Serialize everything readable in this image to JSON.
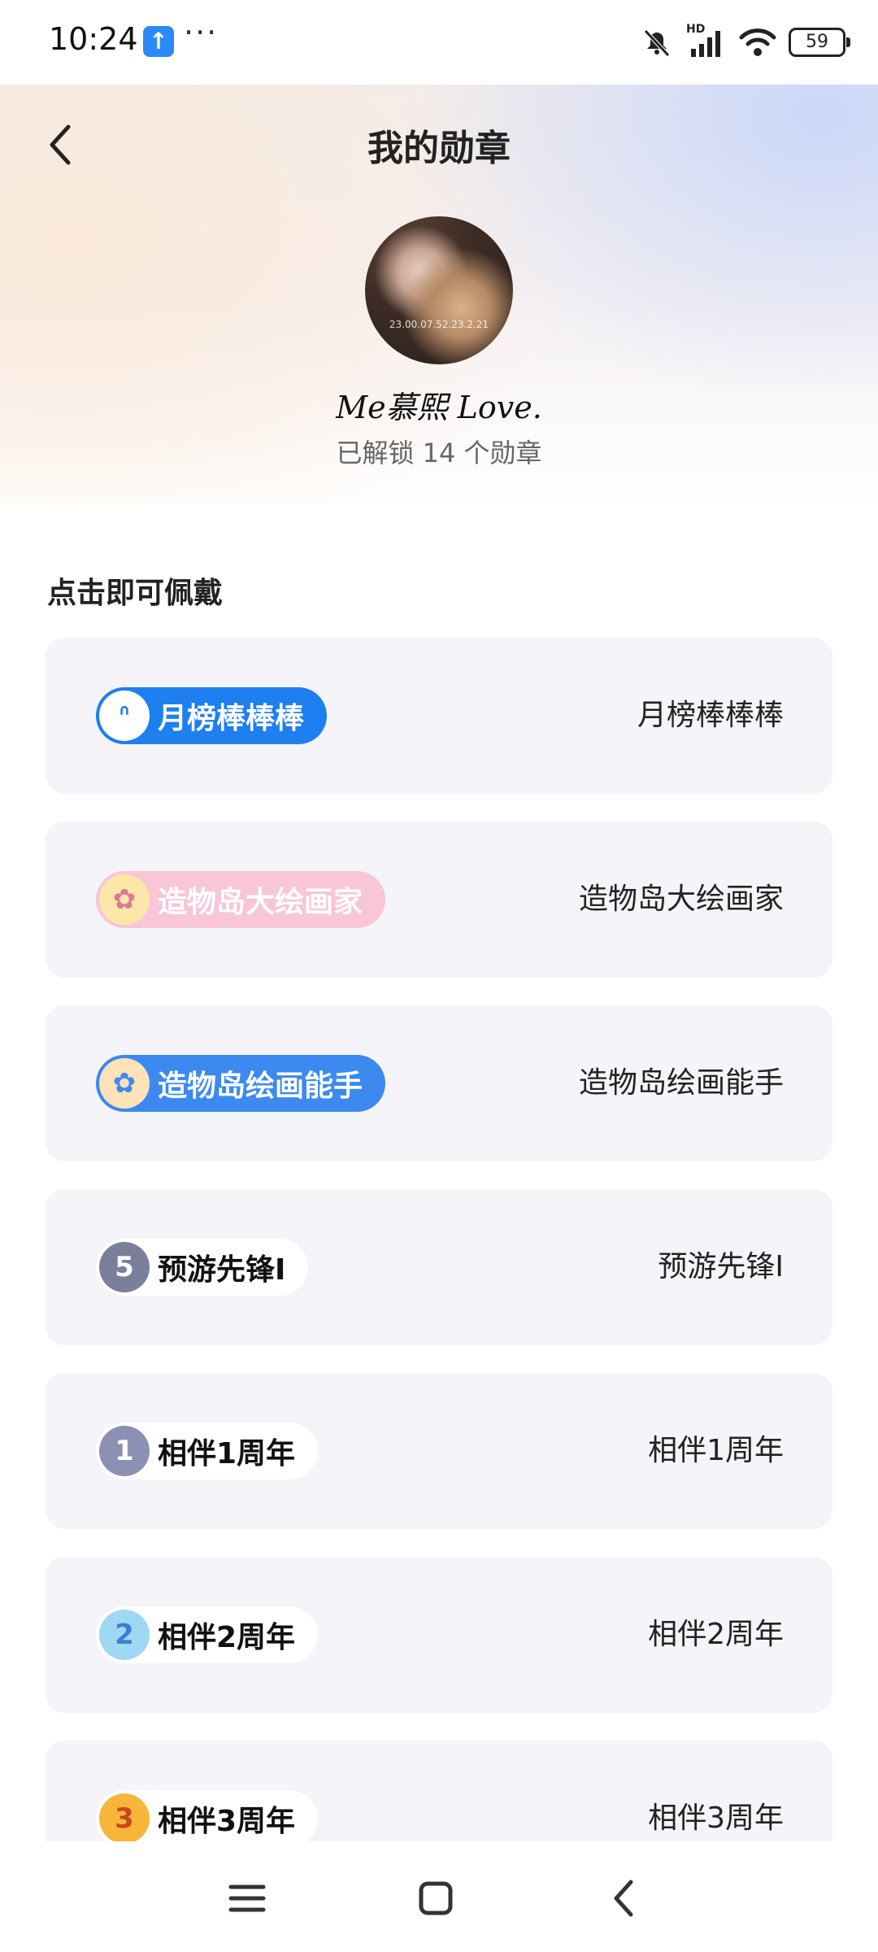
{
  "status_bar": {
    "time": "10:24",
    "battery": "59",
    "network_label": "HD"
  },
  "header": {
    "title": "我的勋章"
  },
  "profile": {
    "avatar_caption": "23.00.07.52.23.2.21",
    "username": "Me慕熙 Love.",
    "unlock_summary": "已解锁 14 个勋章"
  },
  "section": {
    "title": "点击即可佩戴"
  },
  "badges": [
    {
      "pill_label": "月榜棒棒棒",
      "name": "月榜棒棒棒",
      "pill_bg": "#1d7ff0",
      "pill_text": "#ffffff",
      "icon": "bunny-icon",
      "icon_glyph": "ᐢ",
      "icon_bg": "#ffffff",
      "icon_color": "#1d7ff0"
    },
    {
      "pill_label": "造物岛大绘画家",
      "name": "造物岛大绘画家",
      "pill_bg": "#f8c6d6",
      "pill_text": "#ffffff",
      "icon": "anime-girl-icon",
      "icon_glyph": "✿",
      "icon_bg": "#fde7a8",
      "icon_color": "#e07896"
    },
    {
      "pill_label": "造物岛绘画能手",
      "name": "造物岛绘画能手",
      "pill_bg": "#3c8af0",
      "pill_text": "#ffffff",
      "icon": "anime-girl-icon",
      "icon_glyph": "✿",
      "icon_bg": "#ffe2b8",
      "icon_color": "#3c8af0"
    },
    {
      "pill_label": "预游先锋I",
      "name": "预游先锋I",
      "pill_bg": "#ffffff",
      "pill_text": "#111111",
      "icon": "number-5-shield-icon",
      "icon_glyph": "5",
      "icon_bg": "#7a7f9a",
      "icon_color": "#ffffff"
    },
    {
      "pill_label": "相伴1周年",
      "name": "相伴1周年",
      "pill_bg": "#ffffff",
      "pill_text": "#111111",
      "icon": "number-1-shield-icon",
      "icon_glyph": "1",
      "icon_bg": "#8c91b4",
      "icon_color": "#ffffff"
    },
    {
      "pill_label": "相伴2周年",
      "name": "相伴2周年",
      "pill_bg": "#ffffff",
      "pill_text": "#111111",
      "icon": "number-2-shield-icon",
      "icon_glyph": "2",
      "icon_bg": "#9fd8f4",
      "icon_color": "#3a7fd6"
    },
    {
      "pill_label": "相伴3周年",
      "name": "相伴3周年",
      "pill_bg": "#ffffff",
      "pill_text": "#111111",
      "icon": "number-3-shield-icon",
      "icon_glyph": "3",
      "icon_bg": "#f7b63a",
      "icon_color": "#c9461d"
    }
  ]
}
